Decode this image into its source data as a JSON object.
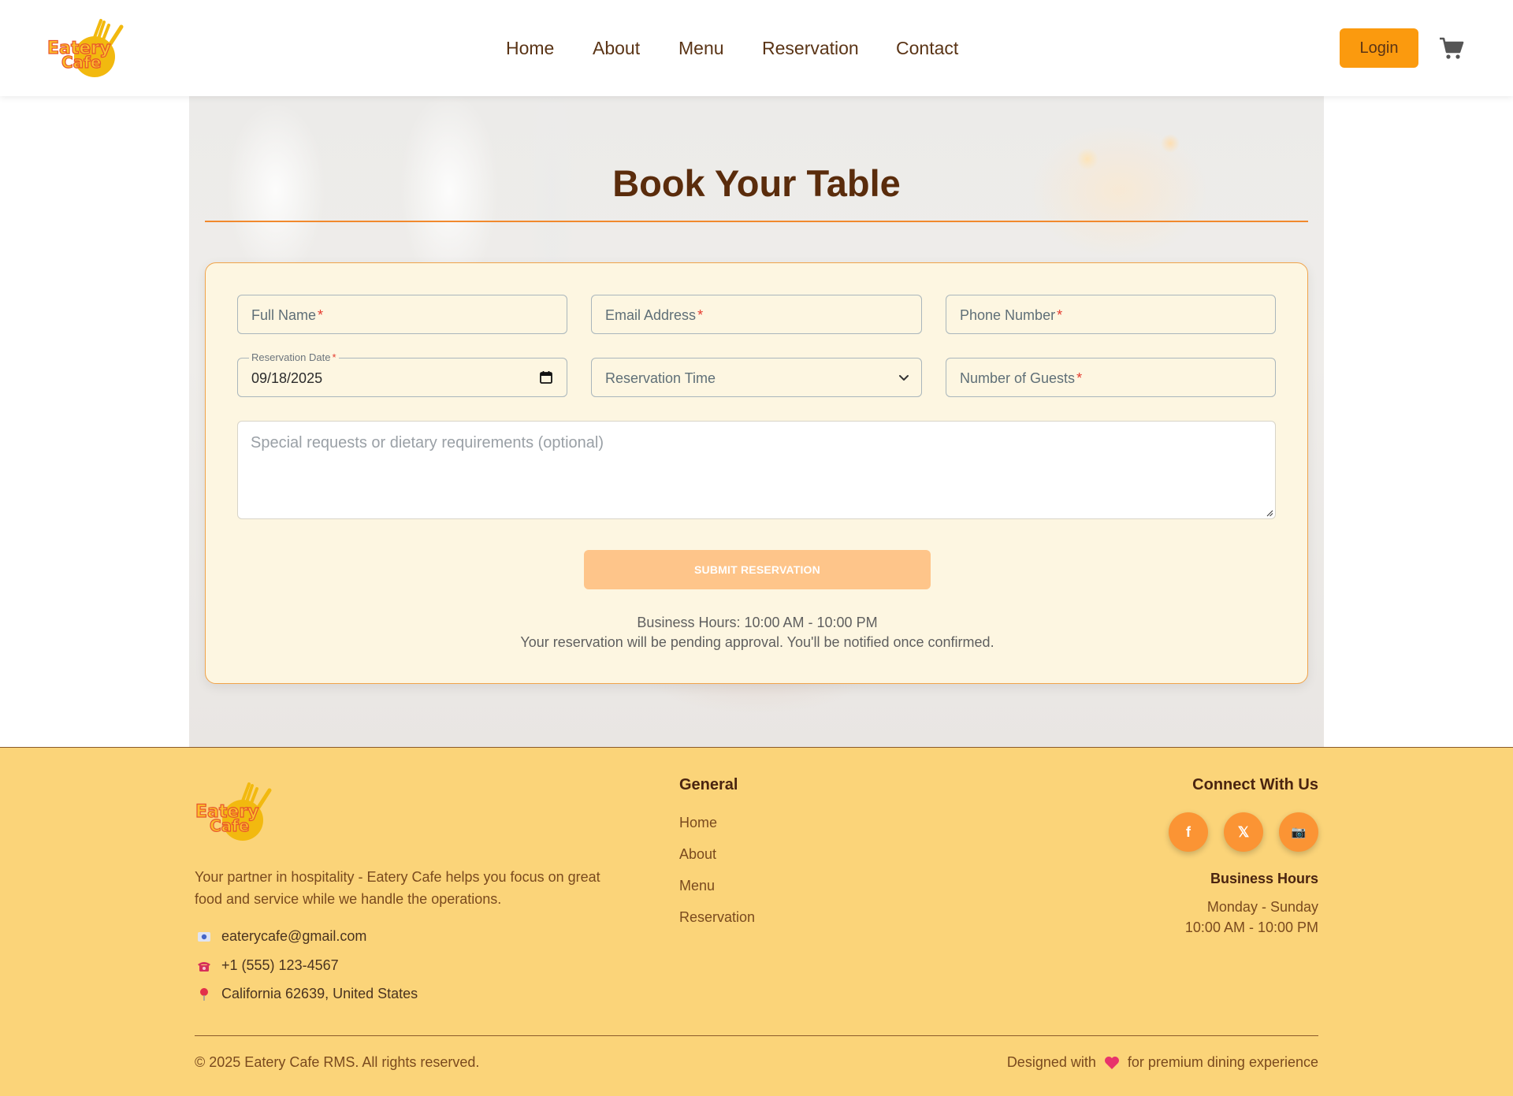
{
  "header": {
    "logo_text_line1": "Eatery",
    "logo_text_line2": "Cafe",
    "nav": [
      "Home",
      "About",
      "Menu",
      "Reservation",
      "Contact"
    ],
    "login_label": "Login",
    "cart_icon": "cart-icon"
  },
  "main": {
    "title": "Book Your Table",
    "form": {
      "full_name_placeholder": "Full Name",
      "email_placeholder": "Email Address",
      "phone_placeholder": "Phone Number",
      "date_label": "Reservation Date",
      "date_value": "09/18/2025",
      "time_placeholder": "Reservation Time",
      "guests_placeholder": "Number of Guests",
      "required_marker": "*",
      "special_requests_placeholder": "Special requests or dietary requirements (optional)",
      "submit_label": "SUBMIT RESERVATION",
      "business_hours_note": "Business Hours: 10:00 AM - 10:00 PM",
      "pending_note": "Your reservation will be pending approval. You'll be notified once confirmed."
    }
  },
  "footer": {
    "description": "Your partner in hospitality - Eatery Cafe helps you focus on great food and service while we handle the operations.",
    "email": "eaterycafe@gmail.com",
    "phone": "+1 (555) 123-4567",
    "address": "California 62639, United States",
    "general_heading": "General",
    "general_links": [
      "Home",
      "About",
      "Menu",
      "Reservation"
    ],
    "connect_heading": "Connect With Us",
    "social": [
      {
        "name": "facebook",
        "glyph": "f"
      },
      {
        "name": "x",
        "glyph": "𝕏"
      },
      {
        "name": "instagram",
        "glyph": "📷"
      }
    ],
    "business_hours_heading": "Business Hours",
    "business_days": "Monday - Sunday",
    "business_time": "10:00 AM - 10:00 PM",
    "copyright": "© 2025 Eatery Cafe RMS. All rights reserved.",
    "designed_prefix": "Designed with",
    "designed_suffix": "for premium dining experience"
  },
  "colors": {
    "accent": "#fb9a0e",
    "brand_brown": "#5a2c0c",
    "footer_bg": "#fbd479",
    "card_bg": "#fdf6e1",
    "submit_disabled": "#fec58a"
  }
}
